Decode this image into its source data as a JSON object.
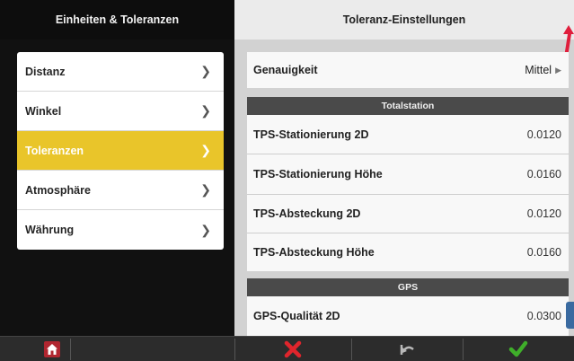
{
  "left": {
    "title": "Einheiten & Toleranzen",
    "items": [
      {
        "label": "Distanz"
      },
      {
        "label": "Winkel"
      },
      {
        "label": "Toleranzen"
      },
      {
        "label": "Atmosphäre"
      },
      {
        "label": "Währung"
      }
    ],
    "active_index": 2,
    "chevron": "❯"
  },
  "right": {
    "title": "Toleranz-Einstellungen",
    "accuracy": {
      "label": "Genauigkeit",
      "value": "Mittel"
    },
    "sections": [
      {
        "title": "Totalstation",
        "rows": [
          {
            "label": "TPS-Stationierung 2D",
            "value": "0.0120"
          },
          {
            "label": "TPS-Stationierung Höhe",
            "value": "0.0160"
          },
          {
            "label": "TPS-Absteckung 2D",
            "value": "0.0120"
          },
          {
            "label": "TPS-Absteckung Höhe",
            "value": "0.0160"
          }
        ]
      },
      {
        "title": "GPS",
        "rows": [
          {
            "label": "GPS-Qualität 2D",
            "value": "0.0300"
          }
        ]
      }
    ]
  },
  "bottom": {
    "icons": [
      "home-icon",
      "cancel-x-icon",
      "undo-icon",
      "confirm-check-icon"
    ]
  },
  "colors": {
    "active_item": "#e9c52a",
    "cancel": "#e0252c",
    "confirm": "#3fae2a",
    "annotation_arrow": "#e01e3c"
  }
}
